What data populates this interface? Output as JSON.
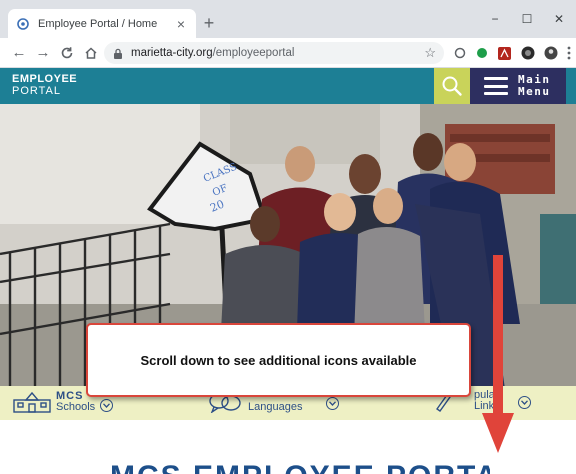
{
  "browser": {
    "tab_title": "Employee Portal / Home",
    "new_tab_label": "+",
    "url_host": "marietta-city.org",
    "url_path": "/employeeportal",
    "window_controls": [
      "−",
      "☐",
      "✕"
    ]
  },
  "site": {
    "logo_line1": "EMPLOYEE",
    "logo_line2": "PORTAL",
    "menu_line1": "Main",
    "menu_line2": "Menu",
    "photo_sign_text": [
      "CLASS",
      "OF",
      "20"
    ]
  },
  "quick_links": [
    {
      "label_top": "MCS",
      "label_bottom": "Schools",
      "icon": "school-building-icon"
    },
    {
      "label_top": "",
      "label_bottom": "Languages",
      "icon": "speech-bubbles-icon"
    },
    {
      "label_top": "pular",
      "label_bottom": "Links",
      "icon": "pencil-icon"
    }
  ],
  "page_heading_cut": "MCS EMPLOYEE PORTAL",
  "annotation": {
    "callout_text": "Scroll down to see additional icons available",
    "arrow_color": "#e0443a"
  },
  "colors": {
    "header_teal": "#1d7f95",
    "search_green": "#c9d35a",
    "menu_navy": "#2d2f60",
    "strip_yellow": "#eef0c4",
    "link_blue": "#2d4f86"
  }
}
